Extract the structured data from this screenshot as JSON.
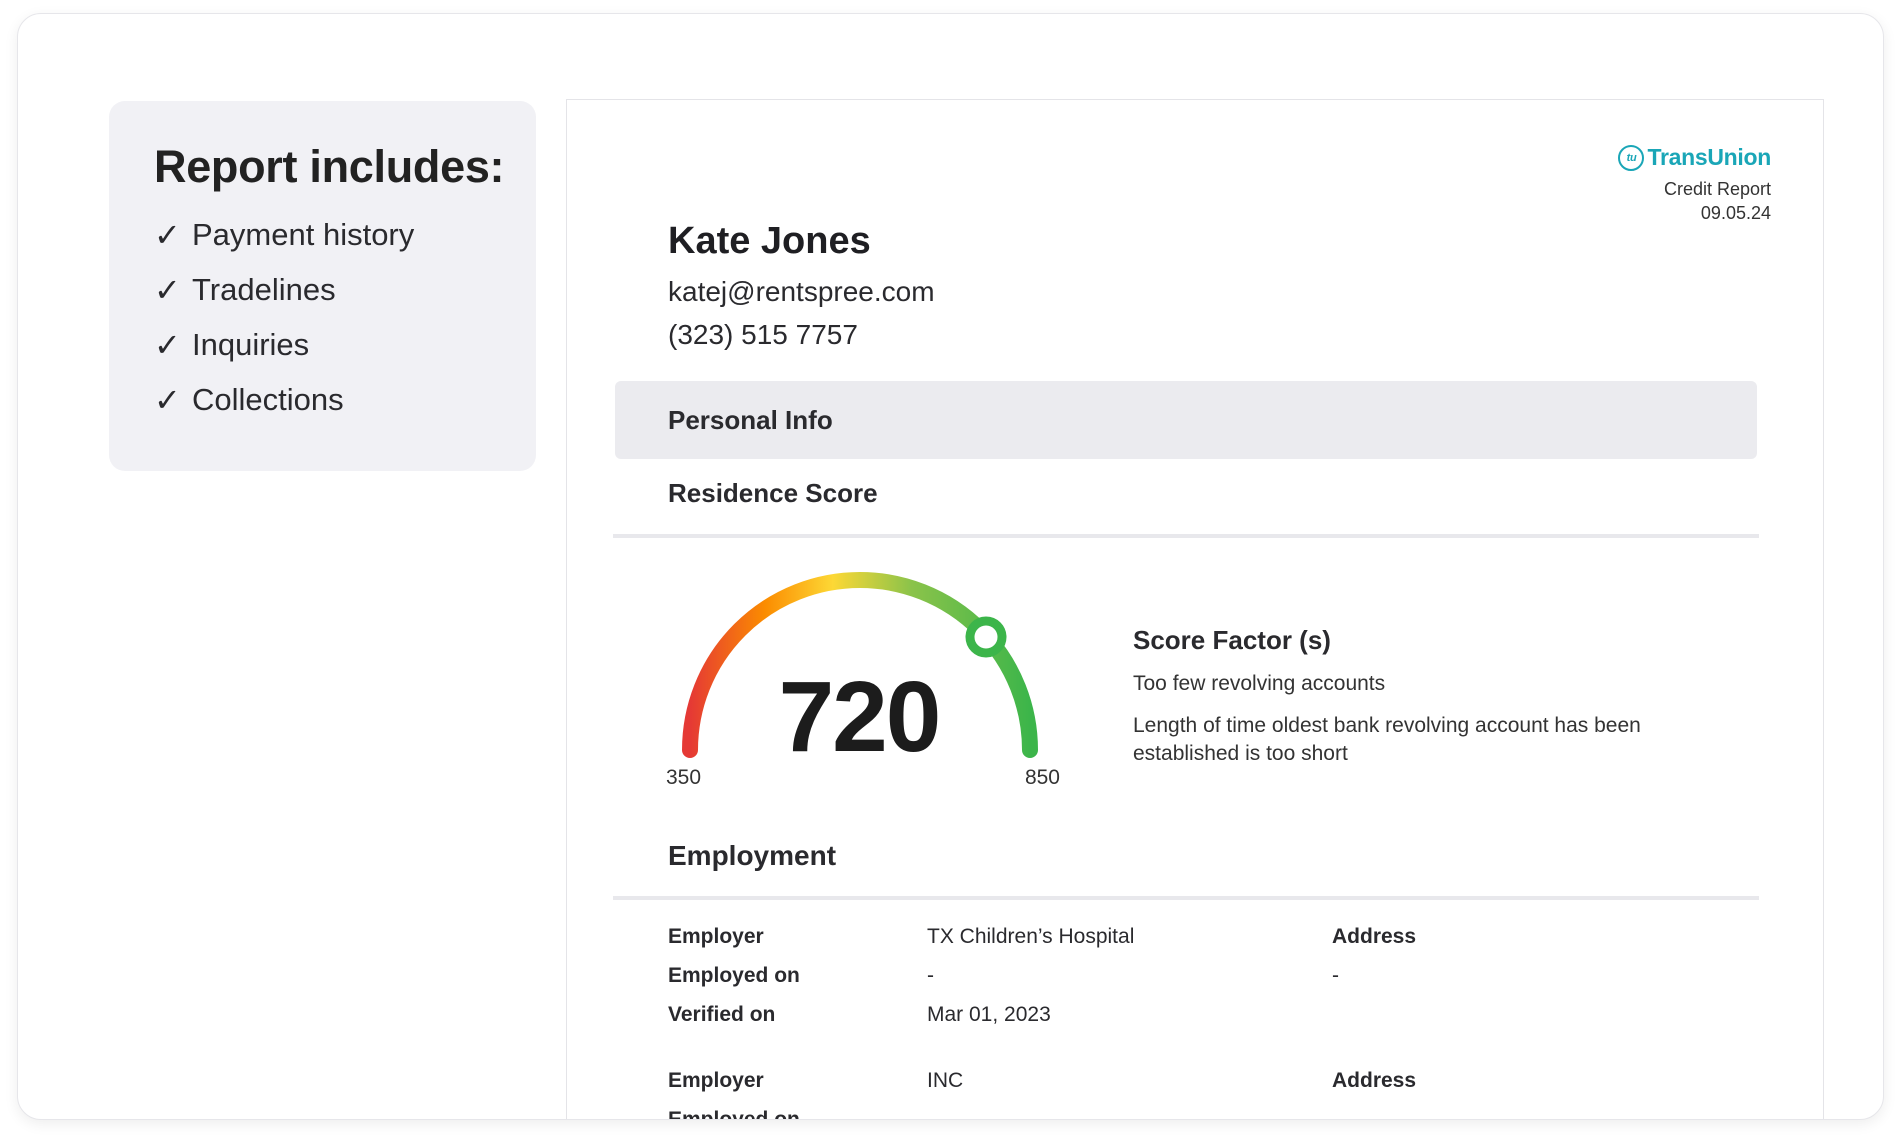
{
  "includes": {
    "title": "Report includes:",
    "items": [
      {
        "check": "✓",
        "label": "Payment history"
      },
      {
        "check": "✓",
        "label": "Tradelines"
      },
      {
        "check": "✓",
        "label": "Inquiries"
      },
      {
        "check": "✓",
        "label": "Collections"
      }
    ]
  },
  "brand": {
    "name": "TransUnion",
    "mark": "tu",
    "color": "#1aa6b7",
    "report_type": "Credit Report",
    "date": "09.05.24"
  },
  "applicant": {
    "name": "Kate Jones",
    "email": "katej@rentspree.com",
    "phone": "(323) 515 7757"
  },
  "sections": {
    "personal_info": "Personal Info",
    "residence_score": "Residence Score",
    "employment": "Employment"
  },
  "score": {
    "value": 720,
    "display": "720",
    "min": "350",
    "max": "850",
    "gradient_colors": [
      "#e53935",
      "#fb8c00",
      "#fdd835",
      "#8bc34a",
      "#3cb54a"
    ]
  },
  "score_factors": {
    "title": "Score Factor (s)",
    "items": [
      "Too few revolving accounts",
      "Length of time oldest bank revolving account has been established is too short"
    ]
  },
  "employment": {
    "records": [
      {
        "employer_label": "Employer",
        "employer": "TX Children’s Hospital",
        "address_label": "Address",
        "employed_on_label": "Employed on",
        "employed_on": "-",
        "address": "-",
        "verified_on_label": "Verified on",
        "verified_on": "Mar 01, 2023"
      },
      {
        "employer_label": "Employer",
        "employer": "INC",
        "address_label": "Address",
        "employed_on_label": "Employed on",
        "employed_on": "-",
        "address": "-"
      }
    ]
  }
}
